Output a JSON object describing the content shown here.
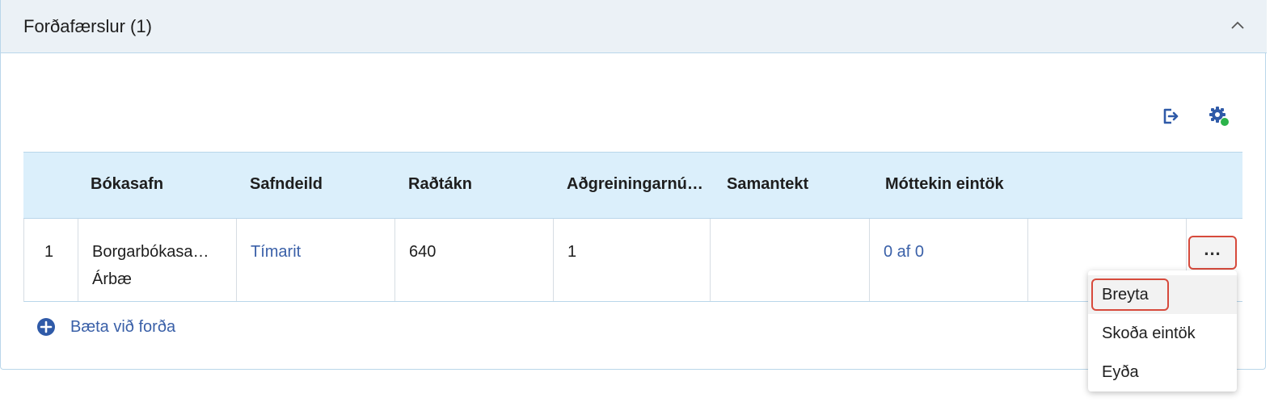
{
  "panel": {
    "title": "Forðafærslur (1)"
  },
  "toolbar": {
    "export_icon": "export-icon",
    "settings_icon": "settings-icon",
    "settings_status_color": "#2bb34a"
  },
  "table": {
    "columns": [
      "Bókasafn",
      "Safndeild",
      "Raðtákn",
      "Aðgreiningarnú…",
      "Samantekt",
      "Móttekin eintök"
    ],
    "rows": [
      {
        "index": "1",
        "library_line1": "Borgarbókasa…",
        "library_line2": "Árbæ",
        "department": "Tímarit",
        "call_number": "640",
        "distinguishing_number": "1",
        "summary": "",
        "received": "0 af 0"
      }
    ],
    "row_actions_label": "..."
  },
  "add_holding": {
    "label": "Bæta við forða"
  },
  "context_menu": {
    "items": [
      "Breyta",
      "Skoða eintök",
      "Eyða"
    ]
  },
  "colors": {
    "accent": "#3a60a8",
    "header_bg": "#dbeffb",
    "highlight": "#d74a3c"
  }
}
